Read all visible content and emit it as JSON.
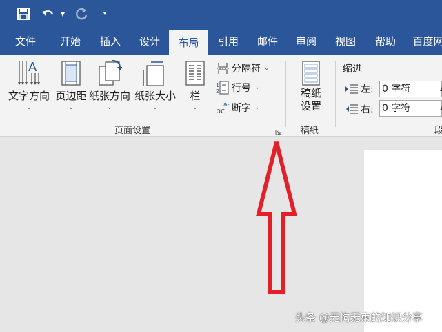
{
  "quick_access": {
    "save_icon": "save-icon",
    "undo_icon": "undo-icon",
    "redo_icon": "redo-icon",
    "customize_icon": "customize-quick-access-icon"
  },
  "tabs": [
    "文件",
    "开始",
    "插入",
    "设计",
    "布局",
    "引用",
    "邮件",
    "审阅",
    "视图",
    "帮助",
    "百度网"
  ],
  "active_tab": "布局",
  "page_setup": {
    "text_direction": "文字方向",
    "margins": "页边距",
    "orientation": "纸张方向",
    "size": "纸张大小",
    "columns": "栏",
    "breaks": "分隔符",
    "line_numbers": "行号",
    "hyphenation": "断字",
    "group_label": "页面设置"
  },
  "manuscript": {
    "button_line1": "稿纸",
    "button_line2": "设置",
    "group_label": "稿纸"
  },
  "indent": {
    "title": "缩进",
    "left_label": "左:",
    "left_value": "0 字符",
    "right_label": "右:",
    "right_value": "0 字符",
    "group_label_partial": "段"
  },
  "watermark": "头条 @无拘无束的知识分享",
  "colors": {
    "ribbon_blue": "#2b579a",
    "arrow_red": "#e32028",
    "ribbon_bg": "#f3f3f3",
    "canvas_bg": "#e6e6e6"
  }
}
